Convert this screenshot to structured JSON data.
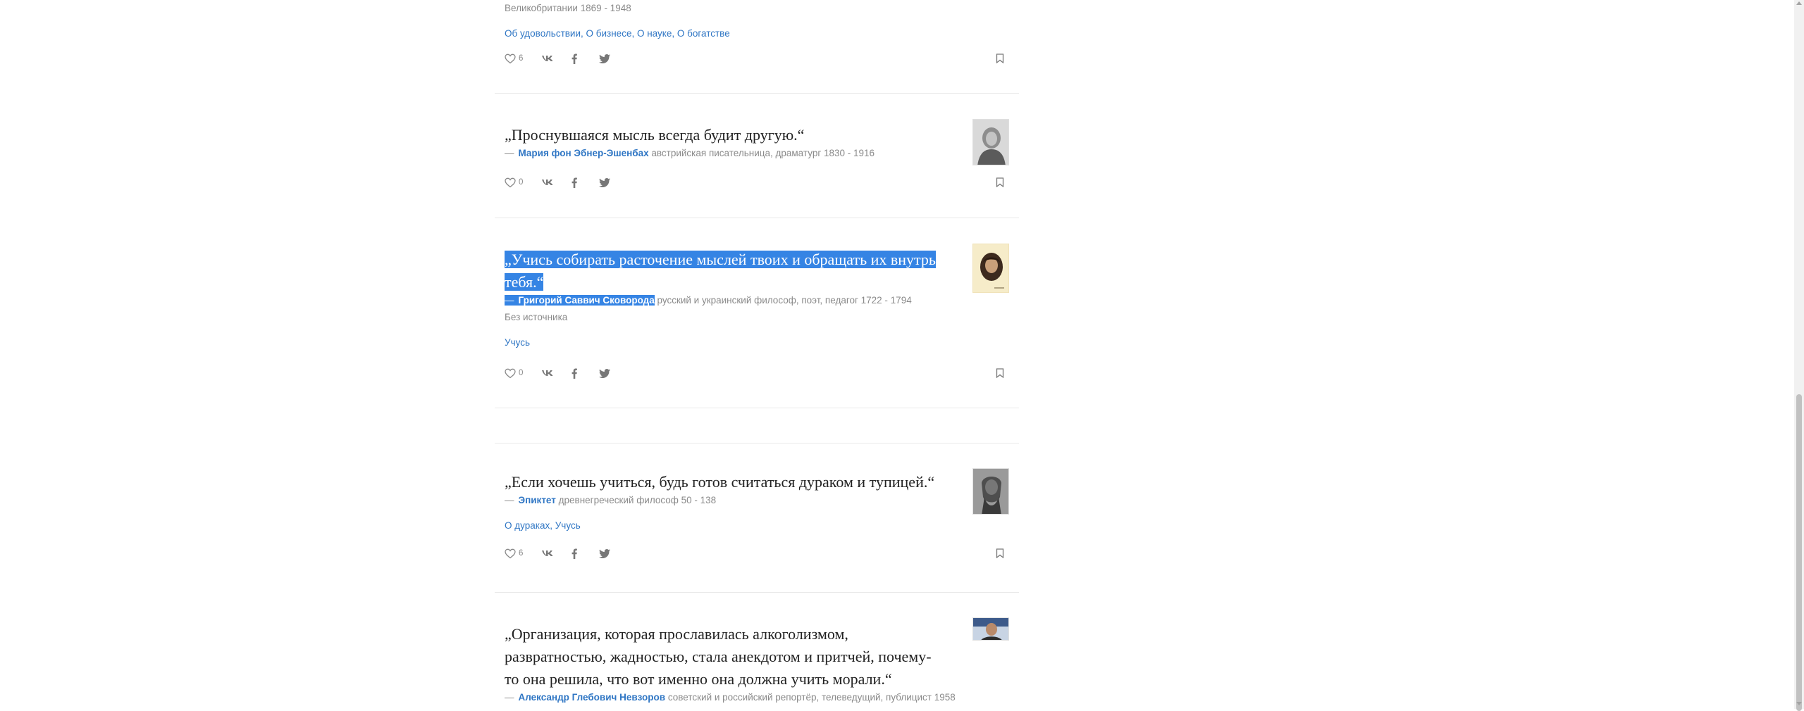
{
  "quotes": [
    {
      "text": "",
      "dash": "",
      "author": "",
      "author_desc": "Великобритании 1869 - 1948",
      "tags": [
        "Об удовольствии",
        "О бизнесе",
        "О науке",
        "О богатстве"
      ],
      "likes": "6"
    },
    {
      "text": "„Проснувшаяся мысль всегда будит другую.“",
      "dash": "—",
      "author": "Мария фон Эбнер-Эшенбах",
      "author_desc": "австрийская писательница, драматург 1830 - 1916",
      "likes": "0"
    },
    {
      "text_line1": "„Учись собирать расточение мыслей твоих и обращать их внутрь",
      "text_line2": "тебя.“",
      "dash": "—",
      "author": "Григорий Саввич Сковорода",
      "author_desc": "русский и украинский философ, поэт, педагог 1722 - 1794",
      "source": "Без источника",
      "tags": [
        "Учусь"
      ],
      "likes": "0"
    },
    {
      "text": "„Если хочешь учиться, будь готов считаться дураком и тупицей.“",
      "dash": "—",
      "author": "Эпиктет",
      "author_desc": "древнегреческий философ 50 - 138",
      "tags": [
        "О дураках",
        "Учусь"
      ],
      "likes": "6"
    },
    {
      "text_line1": "„Организация, которая прославилась алкоголизмом,",
      "text_line2": "развратностью, жадностью, стала анекдотом и притчей, почему-",
      "text_line3": "то она решила, что вот именно она должна учить морали.“",
      "dash": "—",
      "author": "Александр Глебович Невзоров",
      "author_desc": "советский и российский репортёр, телеведущий, публицист 1958"
    }
  ],
  "tag_separator": ", ",
  "icons": {
    "like": "heart-outline-icon",
    "vk": "vk-icon",
    "facebook": "facebook-icon",
    "twitter": "twitter-icon",
    "bookmark": "bookmark-icon"
  },
  "colors": {
    "link": "#2f76c4",
    "selection": "#3584e4",
    "muted": "#8a8a8a",
    "divider": "#e9e9e9"
  }
}
